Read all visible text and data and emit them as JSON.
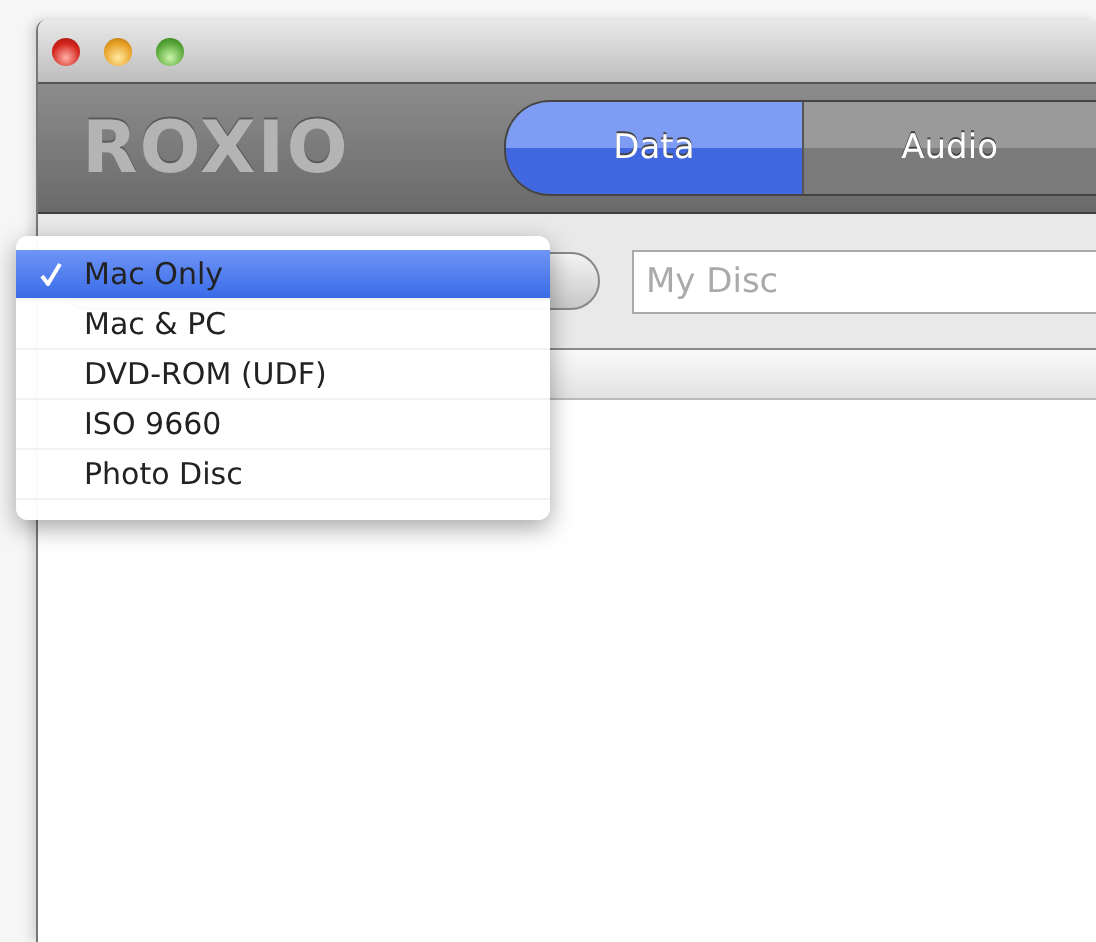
{
  "window": {
    "logo": "ROXIO"
  },
  "tabs": [
    {
      "label": "Data",
      "selected": true
    },
    {
      "label": "Audio",
      "selected": false
    }
  ],
  "disc_name_field": {
    "placeholder": "My Disc"
  },
  "format_menu": {
    "items": [
      {
        "label": "Mac Only",
        "selected": true
      },
      {
        "label": "Mac & PC",
        "selected": false
      },
      {
        "label": "DVD-ROM (UDF)",
        "selected": false
      },
      {
        "label": "ISO 9660",
        "selected": false
      },
      {
        "label": "Photo Disc",
        "selected": false
      }
    ]
  }
}
